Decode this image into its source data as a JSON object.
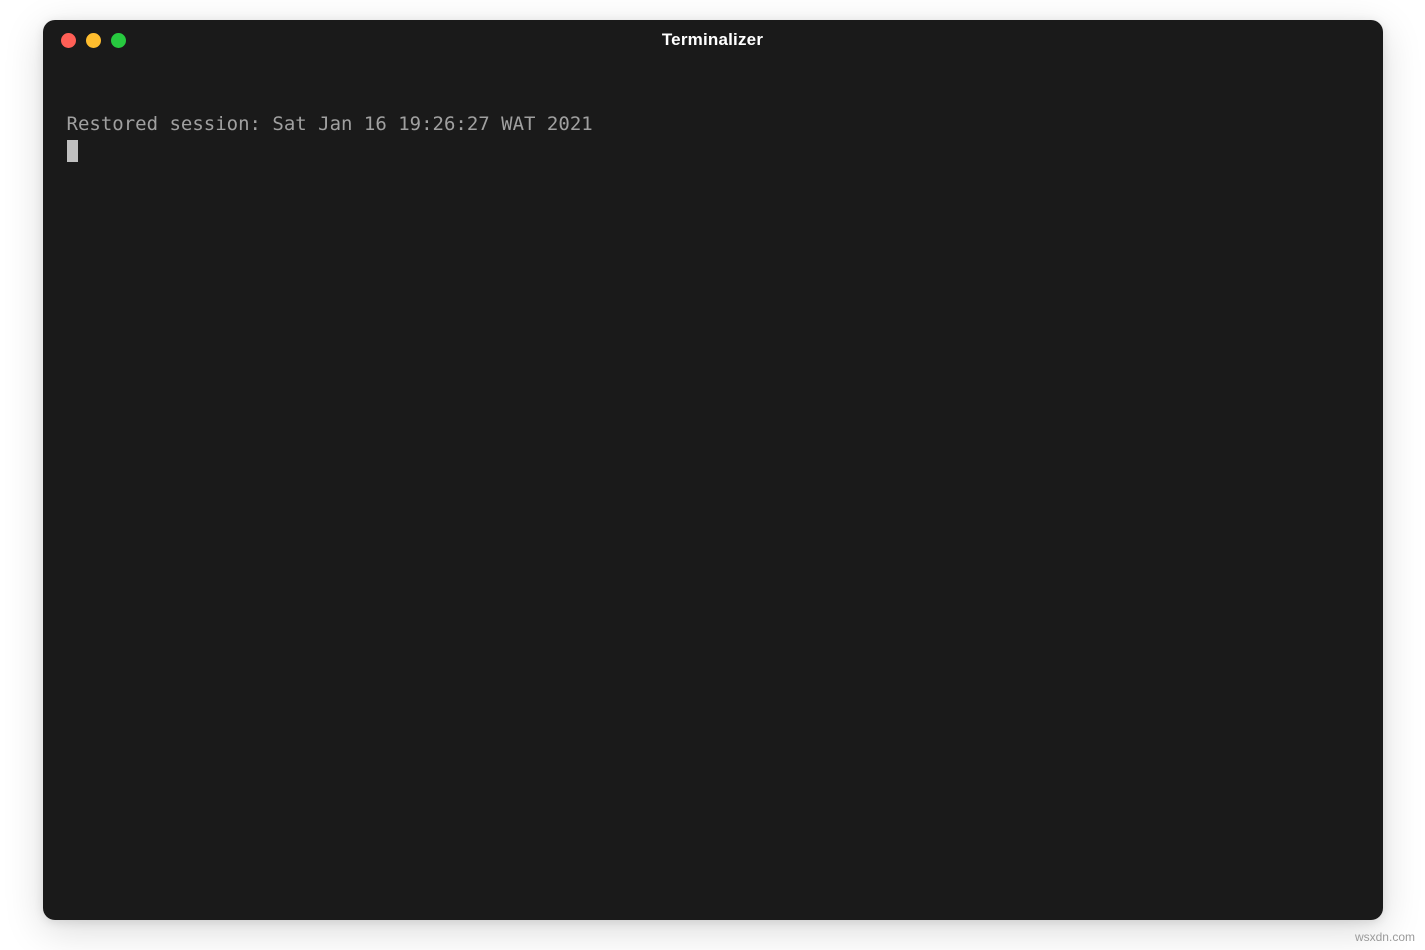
{
  "window": {
    "title": "Terminalizer"
  },
  "terminal": {
    "lines": [
      "Restored session: Sat Jan 16 19:26:27 WAT 2021"
    ]
  },
  "watermark": "wsxdn.com",
  "colors": {
    "close": "#ff5f56",
    "minimize": "#ffbd2e",
    "maximize": "#27c93f",
    "background": "#1a1a1a"
  }
}
